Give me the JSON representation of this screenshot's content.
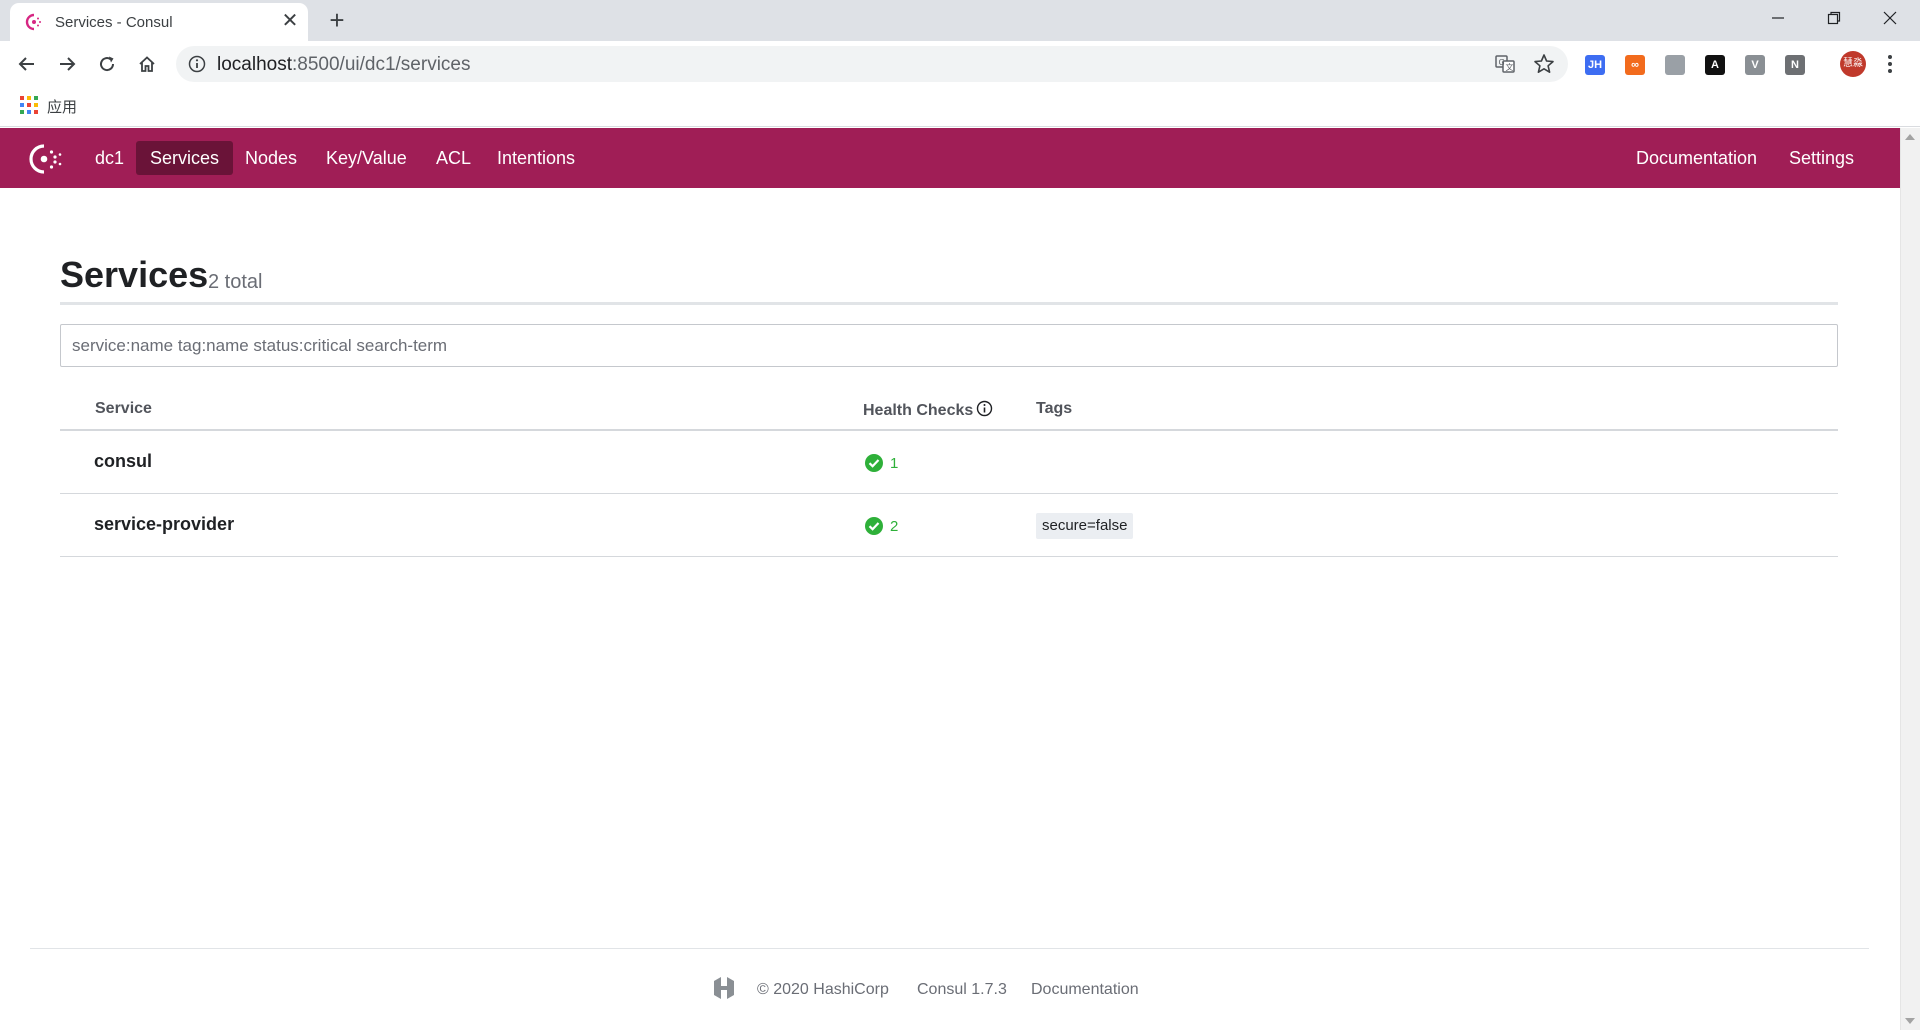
{
  "browser": {
    "tab_title": "Services - Consul",
    "tab_close": "✕",
    "new_tab": "+",
    "url_host": "localhost",
    "url_path": ":8500/ui/dc1/services",
    "bookmarks": {
      "apps_label": "应用"
    },
    "extensions": [
      {
        "name": "jh-extension-icon",
        "text": "JH",
        "color": "#3d6df2"
      },
      {
        "name": "infinity-extension-icon",
        "text": "∞",
        "color": "#f26b1d"
      },
      {
        "name": "bird-extension-icon",
        "text": "",
        "color": "#9aa0a6"
      },
      {
        "name": "a-extension-icon",
        "text": "A",
        "color": "#111111"
      },
      {
        "name": "v-extension-icon",
        "text": "V",
        "color": "#8a8f94"
      },
      {
        "name": "n-extension-icon",
        "text": "N",
        "color": "#6d7073"
      }
    ],
    "profile_initials": "慧淼"
  },
  "nav": {
    "datacenter": "dc1",
    "items": [
      {
        "label": "Services",
        "active": true
      },
      {
        "label": "Nodes",
        "active": false
      },
      {
        "label": "Key/Value",
        "active": false
      },
      {
        "label": "ACL",
        "active": false
      },
      {
        "label": "Intentions",
        "active": false
      }
    ],
    "right": [
      {
        "label": "Documentation"
      },
      {
        "label": "Settings"
      }
    ]
  },
  "page": {
    "title": "Services",
    "count": "2 total",
    "search_placeholder": "service:name tag:name status:critical search-term"
  },
  "table": {
    "headers": {
      "service": "Service",
      "health": "Health Checks",
      "tags": "Tags"
    },
    "rows": [
      {
        "name": "consul",
        "passing": "1",
        "tags": ""
      },
      {
        "name": "service-provider",
        "passing": "2",
        "tags": "secure=false"
      }
    ]
  },
  "footer": {
    "copyright": "© 2020 HashiCorp",
    "version": "Consul 1.7.3",
    "docs": "Documentation"
  },
  "colors": {
    "brand": "#a01e56",
    "brand_active": "#6a1338",
    "passing": "#2eb039"
  }
}
